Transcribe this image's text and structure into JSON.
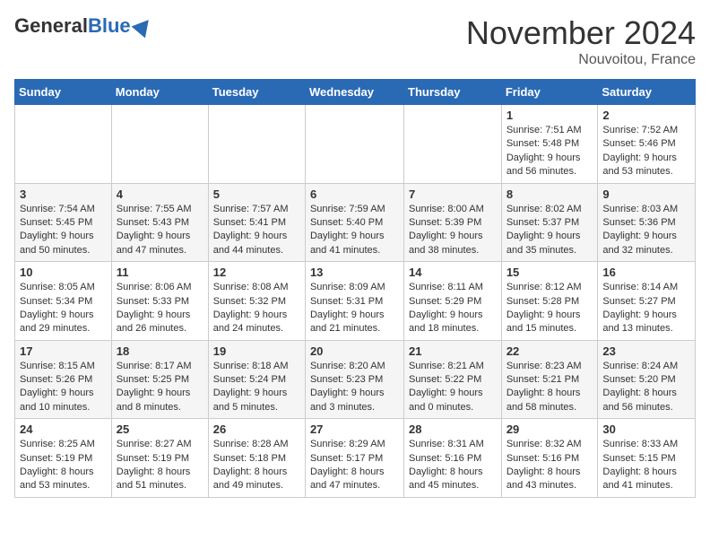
{
  "header": {
    "logo_general": "General",
    "logo_blue": "Blue",
    "month_title": "November 2024",
    "subtitle": "Nouvoitou, France"
  },
  "weekdays": [
    "Sunday",
    "Monday",
    "Tuesday",
    "Wednesday",
    "Thursday",
    "Friday",
    "Saturday"
  ],
  "weeks": [
    [
      {
        "day": "",
        "info": ""
      },
      {
        "day": "",
        "info": ""
      },
      {
        "day": "",
        "info": ""
      },
      {
        "day": "",
        "info": ""
      },
      {
        "day": "",
        "info": ""
      },
      {
        "day": "1",
        "info": "Sunrise: 7:51 AM\nSunset: 5:48 PM\nDaylight: 9 hours and 56 minutes."
      },
      {
        "day": "2",
        "info": "Sunrise: 7:52 AM\nSunset: 5:46 PM\nDaylight: 9 hours and 53 minutes."
      }
    ],
    [
      {
        "day": "3",
        "info": "Sunrise: 7:54 AM\nSunset: 5:45 PM\nDaylight: 9 hours and 50 minutes."
      },
      {
        "day": "4",
        "info": "Sunrise: 7:55 AM\nSunset: 5:43 PM\nDaylight: 9 hours and 47 minutes."
      },
      {
        "day": "5",
        "info": "Sunrise: 7:57 AM\nSunset: 5:41 PM\nDaylight: 9 hours and 44 minutes."
      },
      {
        "day": "6",
        "info": "Sunrise: 7:59 AM\nSunset: 5:40 PM\nDaylight: 9 hours and 41 minutes."
      },
      {
        "day": "7",
        "info": "Sunrise: 8:00 AM\nSunset: 5:39 PM\nDaylight: 9 hours and 38 minutes."
      },
      {
        "day": "8",
        "info": "Sunrise: 8:02 AM\nSunset: 5:37 PM\nDaylight: 9 hours and 35 minutes."
      },
      {
        "day": "9",
        "info": "Sunrise: 8:03 AM\nSunset: 5:36 PM\nDaylight: 9 hours and 32 minutes."
      }
    ],
    [
      {
        "day": "10",
        "info": "Sunrise: 8:05 AM\nSunset: 5:34 PM\nDaylight: 9 hours and 29 minutes."
      },
      {
        "day": "11",
        "info": "Sunrise: 8:06 AM\nSunset: 5:33 PM\nDaylight: 9 hours and 26 minutes."
      },
      {
        "day": "12",
        "info": "Sunrise: 8:08 AM\nSunset: 5:32 PM\nDaylight: 9 hours and 24 minutes."
      },
      {
        "day": "13",
        "info": "Sunrise: 8:09 AM\nSunset: 5:31 PM\nDaylight: 9 hours and 21 minutes."
      },
      {
        "day": "14",
        "info": "Sunrise: 8:11 AM\nSunset: 5:29 PM\nDaylight: 9 hours and 18 minutes."
      },
      {
        "day": "15",
        "info": "Sunrise: 8:12 AM\nSunset: 5:28 PM\nDaylight: 9 hours and 15 minutes."
      },
      {
        "day": "16",
        "info": "Sunrise: 8:14 AM\nSunset: 5:27 PM\nDaylight: 9 hours and 13 minutes."
      }
    ],
    [
      {
        "day": "17",
        "info": "Sunrise: 8:15 AM\nSunset: 5:26 PM\nDaylight: 9 hours and 10 minutes."
      },
      {
        "day": "18",
        "info": "Sunrise: 8:17 AM\nSunset: 5:25 PM\nDaylight: 9 hours and 8 minutes."
      },
      {
        "day": "19",
        "info": "Sunrise: 8:18 AM\nSunset: 5:24 PM\nDaylight: 9 hours and 5 minutes."
      },
      {
        "day": "20",
        "info": "Sunrise: 8:20 AM\nSunset: 5:23 PM\nDaylight: 9 hours and 3 minutes."
      },
      {
        "day": "21",
        "info": "Sunrise: 8:21 AM\nSunset: 5:22 PM\nDaylight: 9 hours and 0 minutes."
      },
      {
        "day": "22",
        "info": "Sunrise: 8:23 AM\nSunset: 5:21 PM\nDaylight: 8 hours and 58 minutes."
      },
      {
        "day": "23",
        "info": "Sunrise: 8:24 AM\nSunset: 5:20 PM\nDaylight: 8 hours and 56 minutes."
      }
    ],
    [
      {
        "day": "24",
        "info": "Sunrise: 8:25 AM\nSunset: 5:19 PM\nDaylight: 8 hours and 53 minutes."
      },
      {
        "day": "25",
        "info": "Sunrise: 8:27 AM\nSunset: 5:19 PM\nDaylight: 8 hours and 51 minutes."
      },
      {
        "day": "26",
        "info": "Sunrise: 8:28 AM\nSunset: 5:18 PM\nDaylight: 8 hours and 49 minutes."
      },
      {
        "day": "27",
        "info": "Sunrise: 8:29 AM\nSunset: 5:17 PM\nDaylight: 8 hours and 47 minutes."
      },
      {
        "day": "28",
        "info": "Sunrise: 8:31 AM\nSunset: 5:16 PM\nDaylight: 8 hours and 45 minutes."
      },
      {
        "day": "29",
        "info": "Sunrise: 8:32 AM\nSunset: 5:16 PM\nDaylight: 8 hours and 43 minutes."
      },
      {
        "day": "30",
        "info": "Sunrise: 8:33 AM\nSunset: 5:15 PM\nDaylight: 8 hours and 41 minutes."
      }
    ]
  ]
}
